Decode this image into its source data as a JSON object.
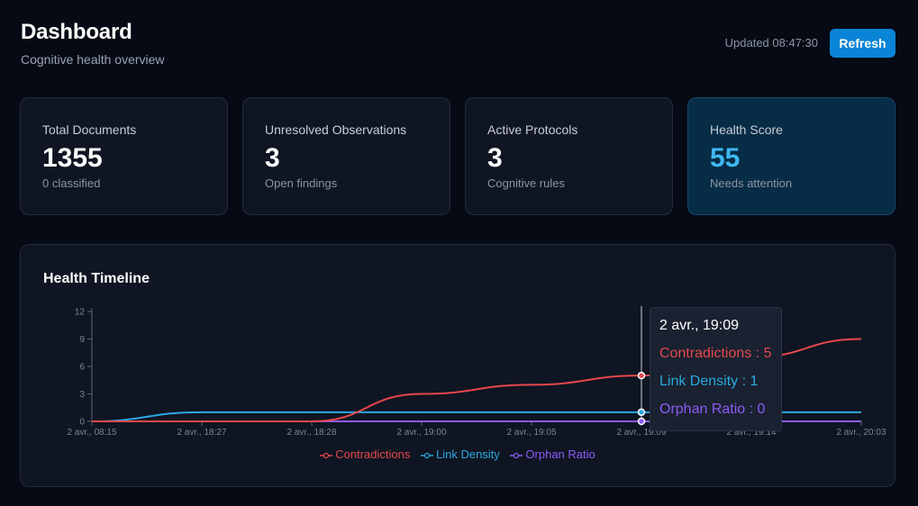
{
  "header": {
    "title": "Dashboard",
    "subtitle": "Cognitive health overview",
    "updated": "Updated 08:47:30",
    "refresh_label": "Refresh"
  },
  "cards": [
    {
      "label": "Total Documents",
      "value": "1355",
      "sub": "0 classified"
    },
    {
      "label": "Unresolved Observations",
      "value": "3",
      "sub": "Open findings"
    },
    {
      "label": "Active Protocols",
      "value": "3",
      "sub": "Cognitive rules"
    },
    {
      "label": "Health Score",
      "value": "55",
      "sub": "Needs attention"
    }
  ],
  "colors": {
    "contradictions": "#e5484d",
    "link_density": "#2aa8e0",
    "orphan_ratio": "#8b5cf6",
    "accent": "#0a84d6",
    "health_value": "#3fb8f2"
  },
  "panel": {
    "title": "Health Timeline"
  },
  "tooltip": {
    "title": "2 avr., 19:09",
    "rows": [
      "Contradictions : 5",
      "Link Density : 1",
      "Orphan Ratio : 0"
    ]
  },
  "chart_data": {
    "type": "line",
    "title": "Health Timeline",
    "x": [
      "2 avr., 08:15",
      "2 avr., 18:27",
      "2 avr., 18:28",
      "2 avr., 19:00",
      "2 avr., 19:05",
      "2 avr., 19:09",
      "2 avr., 19:14",
      "2 avr., 20:03"
    ],
    "yticks": [
      0,
      3,
      6,
      9,
      12
    ],
    "ylim": [
      0,
      12
    ],
    "grid": false,
    "legend": "bottom-center",
    "series": [
      {
        "name": "Contradictions",
        "color": "#e5484d",
        "values": [
          0,
          0,
          0,
          3,
          4,
          5,
          7,
          9
        ]
      },
      {
        "name": "Link Density",
        "color": "#2aa8e0",
        "values": [
          0,
          1,
          1,
          1,
          1,
          1,
          1,
          1
        ]
      },
      {
        "name": "Orphan Ratio",
        "color": "#8b5cf6",
        "values": [
          0,
          0,
          0,
          0,
          0,
          0,
          0,
          0
        ]
      }
    ],
    "active_index": 5
  }
}
